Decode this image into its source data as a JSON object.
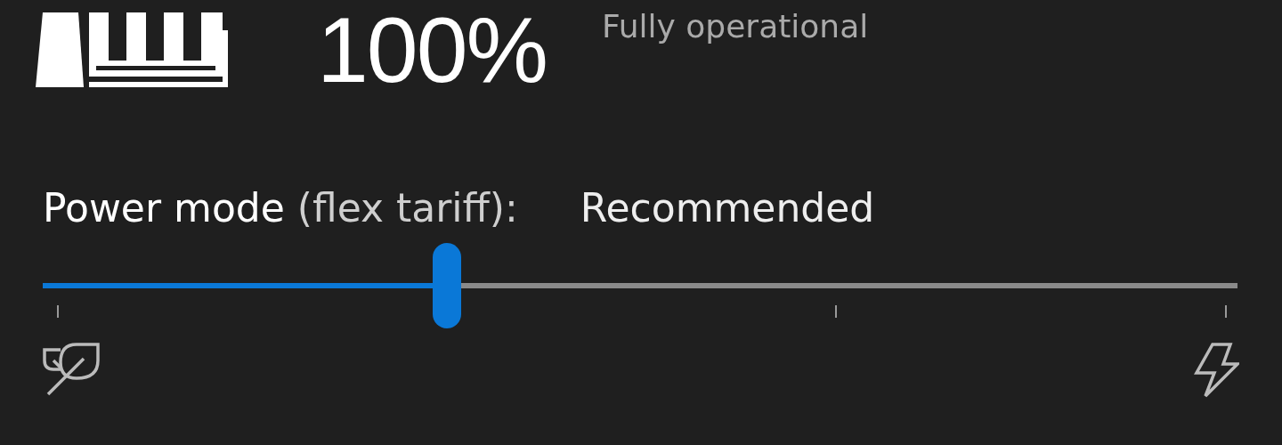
{
  "status": {
    "percentage": "100%",
    "state": "Fully operational"
  },
  "power_mode": {
    "label": "Power mode",
    "qualifier": "(flex tariff):",
    "value": "Recommended",
    "slider": {
      "level": 0.338
    }
  }
}
